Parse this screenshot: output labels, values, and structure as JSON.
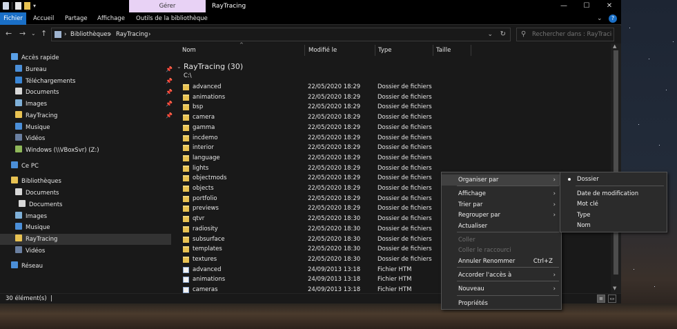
{
  "window": {
    "title": "RayTracing",
    "manage_tab": "Gérer",
    "controls": {
      "minimize": "—",
      "maximize": "☐",
      "close": "✕"
    }
  },
  "ribbon": {
    "tabs": [
      "Fichier",
      "Accueil",
      "Partage",
      "Affichage",
      "Outils de la bibliothèque"
    ],
    "help": "?",
    "expand": "⌄"
  },
  "address": {
    "crumbs": [
      "Bibliothèques",
      "RayTracing"
    ],
    "separator": "›",
    "search_placeholder": "Rechercher dans : RayTracing"
  },
  "navpane": {
    "quick_access": "Accès rapide",
    "quick_items": [
      {
        "label": "Bureau",
        "pinned": true
      },
      {
        "label": "Téléchargements",
        "pinned": true
      },
      {
        "label": "Documents",
        "pinned": true
      },
      {
        "label": "Images",
        "pinned": true
      },
      {
        "label": "RayTracing",
        "pinned": true
      },
      {
        "label": "Musique",
        "pinned": false
      },
      {
        "label": "Vidéos",
        "pinned": false
      },
      {
        "label": "Windows (\\\\VBoxSvr) (Z:)",
        "pinned": false
      }
    ],
    "this_pc": "Ce PC",
    "libraries": "Bibliothèques",
    "library_items": [
      "Documents",
      "Documents",
      "Images",
      "Musique",
      "RayTracing",
      "Vidéos"
    ],
    "network": "Réseau"
  },
  "columns": {
    "name": "Nom",
    "modified": "Modifié le",
    "type": "Type",
    "size": "Taille"
  },
  "group": {
    "title": "RayTracing (30)",
    "subtitle": "C:\\"
  },
  "files": [
    {
      "name": "advanced",
      "date": "22/05/2020 18:29",
      "type": "Dossier de fichiers",
      "kind": "folder"
    },
    {
      "name": "animations",
      "date": "22/05/2020 18:29",
      "type": "Dossier de fichiers",
      "kind": "folder"
    },
    {
      "name": "bsp",
      "date": "22/05/2020 18:29",
      "type": "Dossier de fichiers",
      "kind": "folder"
    },
    {
      "name": "camera",
      "date": "22/05/2020 18:29",
      "type": "Dossier de fichiers",
      "kind": "folder"
    },
    {
      "name": "gamma",
      "date": "22/05/2020 18:29",
      "type": "Dossier de fichiers",
      "kind": "folder"
    },
    {
      "name": "incdemo",
      "date": "22/05/2020 18:29",
      "type": "Dossier de fichiers",
      "kind": "folder"
    },
    {
      "name": "interior",
      "date": "22/05/2020 18:29",
      "type": "Dossier de fichiers",
      "kind": "folder"
    },
    {
      "name": "language",
      "date": "22/05/2020 18:29",
      "type": "Dossier de fichiers",
      "kind": "folder"
    },
    {
      "name": "lights",
      "date": "22/05/2020 18:29",
      "type": "Dossier de fichiers",
      "kind": "folder"
    },
    {
      "name": "objectmods",
      "date": "22/05/2020 18:29",
      "type": "Dossier de fichiers",
      "kind": "folder"
    },
    {
      "name": "objects",
      "date": "22/05/2020 18:29",
      "type": "Dossier de fichiers",
      "kind": "folder"
    },
    {
      "name": "portfolio",
      "date": "22/05/2020 18:29",
      "type": "Dossier de fichiers",
      "kind": "folder"
    },
    {
      "name": "previews",
      "date": "22/05/2020 18:29",
      "type": "Dossier de fichiers",
      "kind": "folder"
    },
    {
      "name": "qtvr",
      "date": "22/05/2020 18:30",
      "type": "Dossier de fichiers",
      "kind": "folder"
    },
    {
      "name": "radiosity",
      "date": "22/05/2020 18:30",
      "type": "Dossier de fichiers",
      "kind": "folder"
    },
    {
      "name": "subsurface",
      "date": "22/05/2020 18:30",
      "type": "Dossier de fichiers",
      "kind": "folder"
    },
    {
      "name": "templates",
      "date": "22/05/2020 18:30",
      "type": "Dossier de fichiers",
      "kind": "folder"
    },
    {
      "name": "textures",
      "date": "22/05/2020 18:30",
      "type": "Dossier de fichiers",
      "kind": "folder"
    },
    {
      "name": "advanced",
      "date": "24/09/2013 13:18",
      "type": "Fichier HTM",
      "kind": "html"
    },
    {
      "name": "animations",
      "date": "24/09/2013 13:18",
      "type": "Fichier HTM",
      "kind": "html"
    },
    {
      "name": "cameras",
      "date": "24/09/2013 13:18",
      "type": "Fichier HTM",
      "kind": "html"
    }
  ],
  "status": {
    "count": "30 élément(s)",
    "cursor": "|"
  },
  "context_menu": {
    "items": [
      {
        "label": "Organiser par",
        "submenu": true,
        "highlight": true
      },
      {
        "label": "Affichage",
        "submenu": true
      },
      {
        "label": "Trier par",
        "submenu": true
      },
      {
        "label": "Regrouper par",
        "submenu": true
      },
      {
        "label": "Actualiser"
      },
      {
        "label": "Coller",
        "disabled": true
      },
      {
        "label": "Coller le raccourci",
        "disabled": true
      },
      {
        "label": "Annuler Renommer",
        "shortcut": "Ctrl+Z"
      },
      {
        "label": "Accorder l'accès à",
        "submenu": true
      },
      {
        "label": "Nouveau",
        "submenu": true
      },
      {
        "label": "Propriétés"
      }
    ],
    "submenu_arrow": "›"
  },
  "arrange_submenu": {
    "items": [
      {
        "label": "Dossier",
        "checked": true
      },
      {
        "label": "Date de modification"
      },
      {
        "label": "Mot clé"
      },
      {
        "label": "Type"
      },
      {
        "label": "Nom"
      }
    ]
  },
  "colors": {
    "accent": "#1a6fc6",
    "manage_tab": "#e8d2f5",
    "folder": "#e8c252",
    "background": "#191919"
  }
}
